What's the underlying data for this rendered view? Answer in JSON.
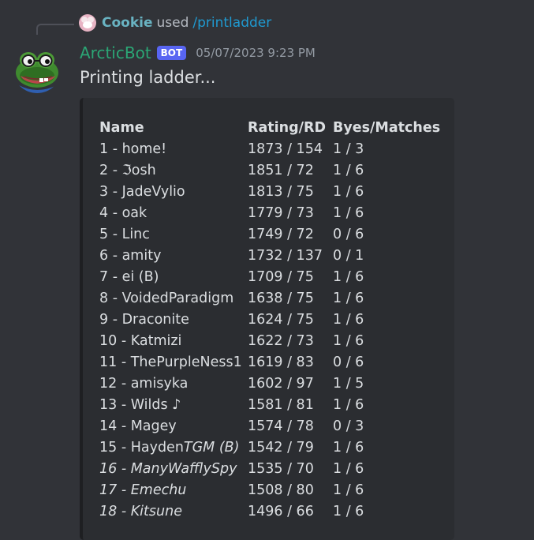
{
  "reply": {
    "user": "Cookie",
    "used_text": "used",
    "command": "/printladder"
  },
  "message": {
    "username": "ArcticBot",
    "bot_tag": "BOT",
    "timestamp": "05/07/2023 9:23 PM",
    "content": "Printing ladder..."
  },
  "table": {
    "headers": [
      "Name",
      "Rating/RD",
      "Byes/Matches"
    ],
    "rows": [
      {
        "name": "1 - home!",
        "rating": "1873 / 154",
        "byes": "1 / 3"
      },
      {
        "name": "2 - ℑosh",
        "rating": "1851 / 72",
        "byes": "1 / 6"
      },
      {
        "name": "3 - JadeVylio",
        "rating": "1813 / 75",
        "byes": "1 / 6"
      },
      {
        "name": "4 - oak",
        "rating": "1779 / 73",
        "byes": "1 / 6"
      },
      {
        "name": "5 - Linc",
        "rating": "1749 / 72",
        "byes": "0 / 6"
      },
      {
        "name": "6 - amity",
        "rating": "1732 / 137",
        "byes": "0 / 1"
      },
      {
        "name": "7 - ei (B)",
        "rating": "1709 / 75",
        "byes": "1 / 6"
      },
      {
        "name": "8 - VoidedParadigm",
        "rating": "1638 / 75",
        "byes": "1 / 6"
      },
      {
        "name": "9 - Draconite",
        "rating": "1624 / 75",
        "byes": "1 / 6"
      },
      {
        "name": "10 - Katmizi",
        "rating": "1622 / 73",
        "byes": "1 / 6"
      },
      {
        "name": "11 - ThePurpleNess1",
        "rating": "1619 / 83",
        "byes": "0 / 6"
      },
      {
        "name": "12 - amisyka",
        "rating": "1602 / 97",
        "byes": "1 / 5"
      },
      {
        "name": "13 - Wilds ♪",
        "rating": "1581 / 81",
        "byes": "1 / 6"
      },
      {
        "name": "14 - Magey",
        "rating": "1574 / 78",
        "byes": "0 / 3"
      },
      {
        "name_plain": "15 - Hayden",
        "name_italic": "TGM (B)",
        "rating": "1542 / 79",
        "byes": "1 / 6"
      },
      {
        "name_italic": "16 - ManyWafflySpy",
        "rating": "1535 / 70",
        "byes": "1 / 6"
      },
      {
        "name_italic": "17 - Emechu",
        "rating": "1508 / 80",
        "byes": "1 / 6"
      },
      {
        "name_italic": "18 - Kitsune",
        "rating": "1496 / 66",
        "byes": "1 / 6"
      }
    ]
  },
  "icons": {
    "reply_avatar": "cookie-avatar-icon",
    "bot_avatar": "frog-with-glasses-avatar"
  },
  "colors": {
    "background": "#313338",
    "username": "#2ba675",
    "reply_user": "#69b3c2",
    "command": "#1f9ad1",
    "bot_tag": "#5865f2",
    "code_block": "#2b2d31"
  }
}
